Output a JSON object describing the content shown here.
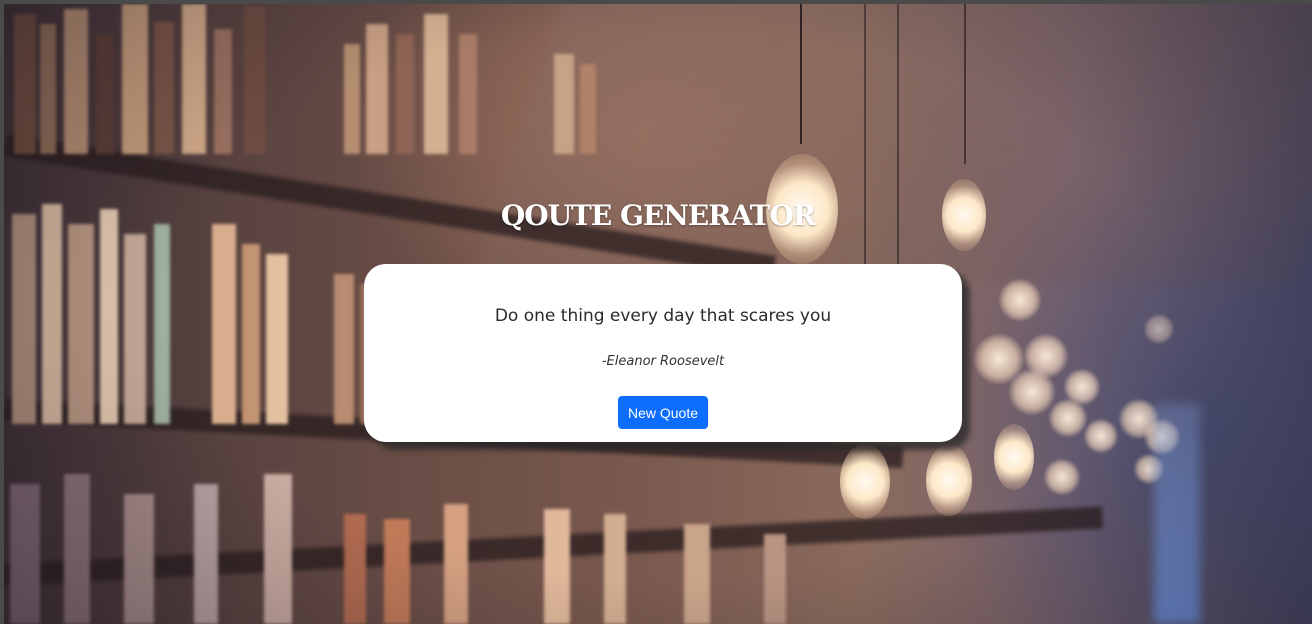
{
  "app": {
    "title": "QOUTE GENERATOR"
  },
  "quote": {
    "text": "Do one thing every day that scares you",
    "author": "-Eleanor Roosevelt"
  },
  "actions": {
    "new_quote_label": "New Quote"
  },
  "colors": {
    "button": "#0d6efd",
    "card": "#ffffff",
    "title": "#ffffff"
  },
  "background": {
    "description_icon": "library-bookshelves-photo"
  }
}
